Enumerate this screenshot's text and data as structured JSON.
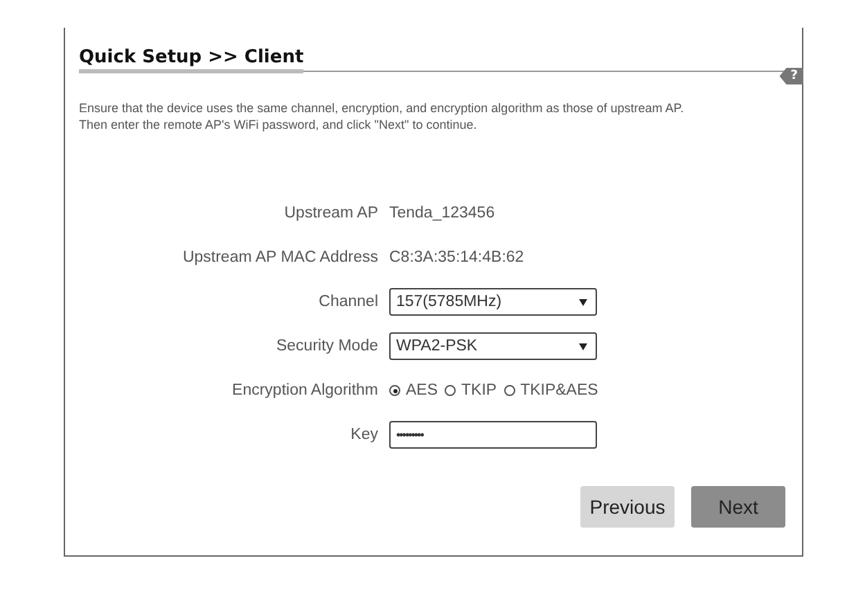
{
  "title": "Quick Setup >> Client",
  "help_badge": "?",
  "description": [
    "Ensure that the device uses the same channel, encryption, and encryption algorithm as those of upstream AP.",
    "Then enter the remote AP's WiFi password, and click \"Next\" to continue."
  ],
  "fields": [
    {
      "kind": "text",
      "label": "Upstream AP",
      "value": "Tenda_123456"
    },
    {
      "kind": "text",
      "label": "Upstream AP MAC Address",
      "value": "C8:3A:35:14:4B:62"
    },
    {
      "kind": "select",
      "label": "Channel",
      "value": "157(5785MHz)"
    },
    {
      "kind": "select",
      "label": "Security Mode",
      "value": "WPA2-PSK"
    },
    {
      "kind": "radio",
      "label": "Encryption Algorithm",
      "options": [
        {
          "label": "AES",
          "selected": true
        },
        {
          "label": "TKIP",
          "selected": false
        },
        {
          "label": "TKIP&AES",
          "selected": false
        }
      ]
    },
    {
      "kind": "password",
      "label": "Key",
      "value": "•••••••••"
    }
  ],
  "buttons": [
    {
      "label": "Previous",
      "kind": "secondary"
    },
    {
      "label": "Next",
      "kind": "primary"
    }
  ]
}
